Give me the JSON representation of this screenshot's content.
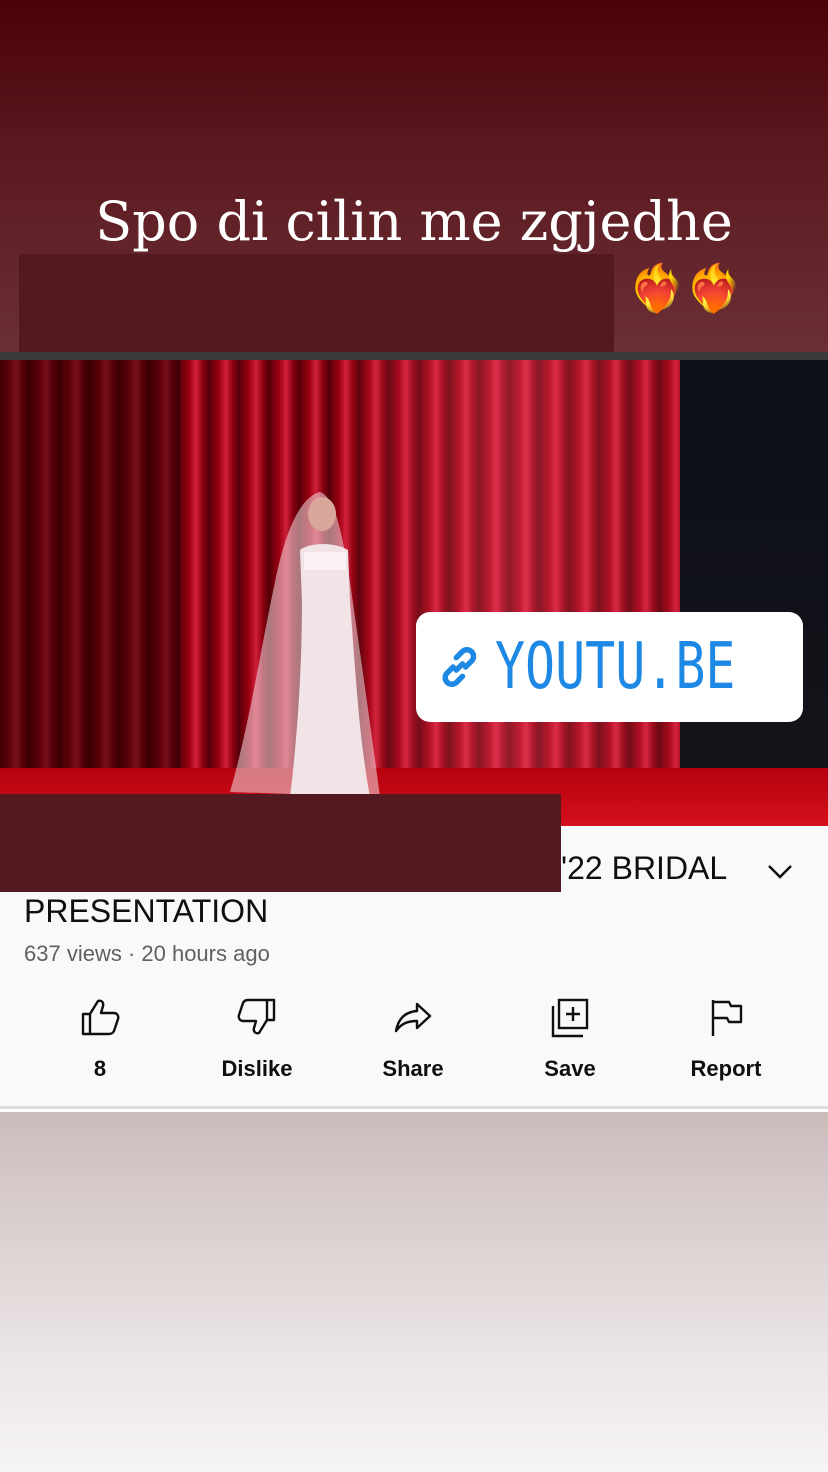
{
  "story": {
    "caption": "Spo di cilin me zgjedhe",
    "emoji": "❤️‍🔥❤️‍🔥"
  },
  "link_sticker": {
    "label": "YOUTU.BE",
    "color": "#1e88e5"
  },
  "video": {
    "title_visible_tail": "'22 BRIDAL",
    "title_line2": "PRESENTATION",
    "meta": "637 views · 20 hours ago"
  },
  "actions": [
    {
      "label": "8",
      "icon": "thumbs-up-icon"
    },
    {
      "label": "Dislike",
      "icon": "thumbs-down-icon"
    },
    {
      "label": "Share",
      "icon": "share-icon"
    },
    {
      "label": "Save",
      "icon": "save-to-playlist-icon"
    },
    {
      "label": "Report",
      "icon": "flag-icon"
    }
  ],
  "colors": {
    "redaction": "#521a20",
    "text_primary": "#0f0f0f",
    "text_secondary": "#606060"
  }
}
